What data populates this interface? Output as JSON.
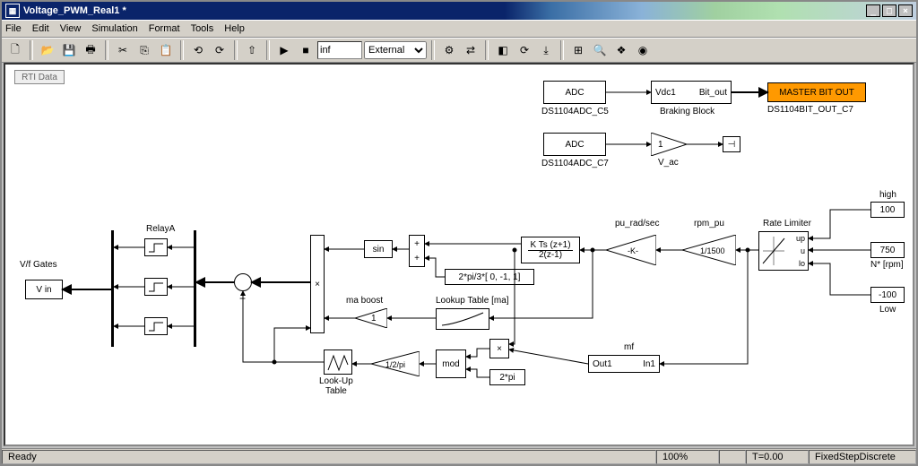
{
  "window": {
    "title": "Voltage_PWM_Real1 *"
  },
  "menu": {
    "file": "File",
    "edit": "Edit",
    "view": "View",
    "simulation": "Simulation",
    "format": "Format",
    "tools": "Tools",
    "help": "Help"
  },
  "toolbar": {
    "stoptime": "inf",
    "mode": "External"
  },
  "status": {
    "ready": "Ready",
    "zoom": "100%",
    "time": "T=0.00",
    "solver": "FixedStepDiscrete"
  },
  "rti": "RTI Data",
  "blocks": {
    "adc1": "ADC",
    "adc1_name": "DS1104ADC_C5",
    "brake_in": "Vdc1",
    "brake_out": "Bit_out",
    "brake_name": "Braking Block",
    "master": "MASTER BIT OUT",
    "master_name": "DS1104BIT_OUT_C7",
    "adc2": "ADC",
    "adc2_name": "DS1104ADC_C7",
    "gain1": "1",
    "vac": "V_ac",
    "high": "high",
    "high_val": "100",
    "nstar": "750",
    "nstar_lbl": "N* [rpm]",
    "low": "Low",
    "low_val": "-100",
    "ratelim": "Rate Limiter",
    "ratelim_up": "up",
    "ratelim_u": "u",
    "ratelim_lo": "lo",
    "rpm_pu": "rpm_pu",
    "rpm_pu_val": "1/1500",
    "pu_rad": "pu_rad/sec",
    "pu_rad_gain": "-K-",
    "integ_num": "K Ts (z+1)",
    "integ_den": "2(z-1)",
    "phase": "2*pi/3*[ 0, -1, 1]",
    "sin": "sin",
    "ma_boost": "ma  boost",
    "ma_gain": "1",
    "lookup_ma": "Lookup Table [ma]",
    "mf": "mf",
    "mf_out": "Out1",
    "mf_in": "In1",
    "twopi": "2*pi",
    "mod": "mod",
    "half_pi": "1/2/pi",
    "lut": "Look-Up\nTable",
    "relayA": "RelayA",
    "vf": "V/f Gates",
    "vin": "V in"
  },
  "chart_data": {
    "type": "diagram",
    "tool": "Simulink (MATLAB)",
    "model_name": "Voltage_PWM_Real1",
    "blocks": [
      {
        "id": "adc1",
        "type": "ADC",
        "name": "DS1104ADC_C5"
      },
      {
        "id": "brake",
        "type": "Subsystem",
        "name": "Braking Block",
        "ports": {
          "in": [
            "Vdc1"
          ],
          "out": [
            "Bit_out"
          ]
        }
      },
      {
        "id": "bitout",
        "type": "DigitalOut",
        "name": "DS1104BIT_OUT_C7",
        "label": "MASTER BIT OUT"
      },
      {
        "id": "adc2",
        "type": "ADC",
        "name": "DS1104ADC_C7"
      },
      {
        "id": "gain_vac",
        "type": "Gain",
        "value": 1,
        "name": "V_ac"
      },
      {
        "id": "term1",
        "type": "Terminator"
      },
      {
        "id": "const_high",
        "type": "Constant",
        "value": 100,
        "name": "high"
      },
      {
        "id": "const_nstar",
        "type": "Constant",
        "value": 750,
        "name": "N* [rpm]"
      },
      {
        "id": "const_low",
        "type": "Constant",
        "value": -100,
        "name": "Low"
      },
      {
        "id": "ratelim",
        "type": "RateLimiter",
        "name": "Rate Limiter",
        "ports": {
          "in": [
            "up",
            "u",
            "lo"
          ]
        }
      },
      {
        "id": "gain_rpm_pu",
        "type": "Gain",
        "value": "1/1500",
        "name": "rpm_pu"
      },
      {
        "id": "gain_pu_rad",
        "type": "Gain",
        "value": "-K-",
        "name": "pu_rad/sec"
      },
      {
        "id": "integ",
        "type": "DiscreteIntegrator",
        "expr": "K Ts (z+1) / 2(z-1)"
      },
      {
        "id": "phase",
        "type": "Constant",
        "value": "2*pi/3*[0,-1,1]"
      },
      {
        "id": "sum_phase",
        "type": "Sum",
        "inputs": "++"
      },
      {
        "id": "sin",
        "type": "Trigonometry",
        "fn": "sin"
      },
      {
        "id": "gain_ma",
        "type": "Gain",
        "value": 1,
        "name": "ma boost"
      },
      {
        "id": "lookup_ma",
        "type": "Lookup1D",
        "name": "Lookup Table [ma]"
      },
      {
        "id": "product_main",
        "type": "Product",
        "inputs": 3
      },
      {
        "id": "mf",
        "type": "Subsystem",
        "name": "mf",
        "ports": {
          "in": [
            "In1"
          ],
          "out": [
            "Out1"
          ]
        }
      },
      {
        "id": "product_mf",
        "type": "Product",
        "inputs": 2
      },
      {
        "id": "const_2pi",
        "type": "Constant",
        "value": "2*pi"
      },
      {
        "id": "mod",
        "type": "MathFunction",
        "fn": "mod"
      },
      {
        "id": "gain_1_2pi",
        "type": "Gain",
        "value": "1/2/pi"
      },
      {
        "id": "lut_tri",
        "type": "Lookup1D",
        "name": "Look-Up Table"
      },
      {
        "id": "sum_cmp",
        "type": "Sum",
        "inputs": "+-"
      },
      {
        "id": "relayA",
        "type": "Relay",
        "name": "RelayA",
        "count": 3
      },
      {
        "id": "vf_gates",
        "type": "BusBar",
        "name": "V/f Gates"
      },
      {
        "id": "vin",
        "type": "Outport",
        "name": "V in"
      }
    ],
    "connections": [
      [
        "adc1",
        "brake.Vdc1"
      ],
      [
        "brake.Bit_out",
        "bitout"
      ],
      [
        "adc2",
        "gain_vac"
      ],
      [
        "gain_vac",
        "term1"
      ],
      [
        "const_high",
        "ratelim.up"
      ],
      [
        "const_nstar",
        "ratelim.u"
      ],
      [
        "const_low",
        "ratelim.lo"
      ],
      [
        "ratelim",
        "gain_rpm_pu"
      ],
      [
        "gain_rpm_pu",
        "gain_pu_rad"
      ],
      [
        "gain_pu_rad",
        "integ"
      ],
      [
        "integ",
        "sum_phase.1"
      ],
      [
        "phase",
        "sum_phase.2"
      ],
      [
        "sum_phase",
        "sin"
      ],
      [
        "sin",
        "product_main.1"
      ],
      [
        "gain_pu_rad",
        "lookup_ma"
      ],
      [
        "lookup_ma",
        "gain_ma"
      ],
      [
        "gain_ma",
        "product_main.2"
      ],
      [
        "ratelim",
        "mf.In1"
      ],
      [
        "mf.Out1",
        "product_mf.1"
      ],
      [
        "integ",
        "product_mf.2"
      ],
      [
        "product_mf",
        "mod.1"
      ],
      [
        "const_2pi",
        "mod.2"
      ],
      [
        "mod",
        "gain_1_2pi"
      ],
      [
        "gain_1_2pi",
        "lut_tri"
      ],
      [
        "lut_tri",
        "product_main.3"
      ],
      [
        "product_main",
        "sum_cmp.+"
      ],
      [
        "lut_tri",
        "sum_cmp.-"
      ],
      [
        "sum_cmp",
        "relayA"
      ],
      [
        "relayA",
        "vf_gates"
      ],
      [
        "vf_gates",
        "vin"
      ]
    ]
  }
}
